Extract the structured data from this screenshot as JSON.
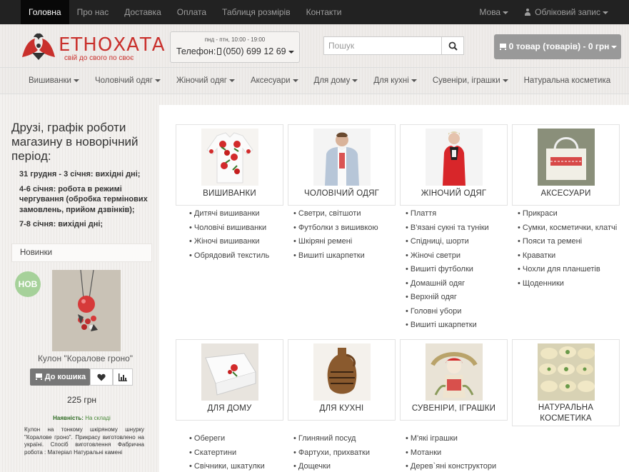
{
  "topbar": {
    "nav": [
      "Головна",
      "Про нас",
      "Доставка",
      "Оплата",
      "Таблиця розмірів",
      "Контакти"
    ],
    "language": "Мова",
    "account": "Обліковий запис"
  },
  "header": {
    "logo_name": "ЕТНОХАТА",
    "logo_slogan": "свій до свого по своє",
    "phone_hours": "пнд - птн, 10:00 - 19:00",
    "phone_label": "Телефон:",
    "phone_number": "(050) 699 12 69",
    "search_placeholder": "Пошук",
    "cart_label": "0 товар (товарів) - 0 грн"
  },
  "categories_nav": [
    {
      "label": "Вишиванки",
      "has_dropdown": true
    },
    {
      "label": "Чоловічий одяг",
      "has_dropdown": true
    },
    {
      "label": "Жіночий одяг",
      "has_dropdown": true
    },
    {
      "label": "Аксесуари",
      "has_dropdown": true
    },
    {
      "label": "Для дому",
      "has_dropdown": true
    },
    {
      "label": "Для кухні",
      "has_dropdown": true
    },
    {
      "label": "Сувеніри, іграшки",
      "has_dropdown": true
    },
    {
      "label": "Натуральна косметика",
      "has_dropdown": false
    }
  ],
  "sidebar": {
    "title": "Друзі, графік роботи магазину в новорічний період:",
    "notes": [
      "31 грудня - 3 січня: вихідні дні;",
      "4-6 січня: робота в режимі чергування (обробка термінових замовлень, прийом дзвінків);",
      "7-8 січня: вихідні дні;"
    ],
    "new_header": "Новинки",
    "badge": "НОВ",
    "product_name": "Кулон \"Коралове гроно\"",
    "add_to_cart": "До кошика",
    "price": "225 грн",
    "availability_label": "Наявність:",
    "availability_value": "На складі",
    "description": "Кулон на тонкому шкіряному шнурку \"Коралове гроно\". Прикрасу виготовлено на україні. Спосіб виготовлення Фабрична робота : Матеріал Натуральні камені"
  },
  "main": {
    "cards": [
      {
        "title": "ВИШИВАНКИ",
        "items": [
          "Дитячі вишиванки",
          "Чоловічі вишиванки",
          "Жіночі вишиванки",
          "Обрядовий текстиль"
        ]
      },
      {
        "title": "ЧОЛОВІЧИЙ ОДЯГ",
        "items": [
          "Светри, світшоти",
          "Футболки з вишивкою",
          "Шкіряні ремені",
          "Вишиті шкарпетки"
        ]
      },
      {
        "title": "ЖІНОЧИЙ ОДЯГ",
        "items": [
          "Плаття",
          "В'язані сукні та туніки",
          "Спідниці, шорти",
          "Жіночі светри",
          "Вишиті футболки",
          "Домашній одяг",
          "Верхній одяг",
          "Головні убори",
          "Вишиті шкарпетки"
        ]
      },
      {
        "title": "АКСЕСУАРИ",
        "items": [
          "Прикраси",
          "Сумки, косметички, клатчі",
          "Пояси та ремені",
          "Краватки",
          "Чохли для планшетів",
          "Щоденники"
        ]
      },
      {
        "title": "ДЛЯ ДОМУ",
        "items": [
          "Обереги",
          "Скатертини",
          "Свічники, шкатулки"
        ]
      },
      {
        "title": "ДЛЯ КУХНІ",
        "items": [
          "Глиняний посуд",
          "Фартухи, прихватки",
          "Дощечки"
        ]
      },
      {
        "title": "СУВЕНІРИ, ІГРАШКИ",
        "items": [
          "М'які іграшки",
          "Мотанки",
          "Дерев`яні конструктори"
        ]
      },
      {
        "title": "НАТУРАЛЬНА КОСМЕТИКА",
        "items": []
      }
    ],
    "cosmetics_title_line1": "НАТУРАЛЬНА",
    "cosmetics_title_line2": "КОСМЕТИКА"
  },
  "colors": {
    "topbar_bg": "#222222",
    "brand_red": "#c9302c",
    "cart_button": "#999999",
    "badge_green": "#a6d19a"
  }
}
